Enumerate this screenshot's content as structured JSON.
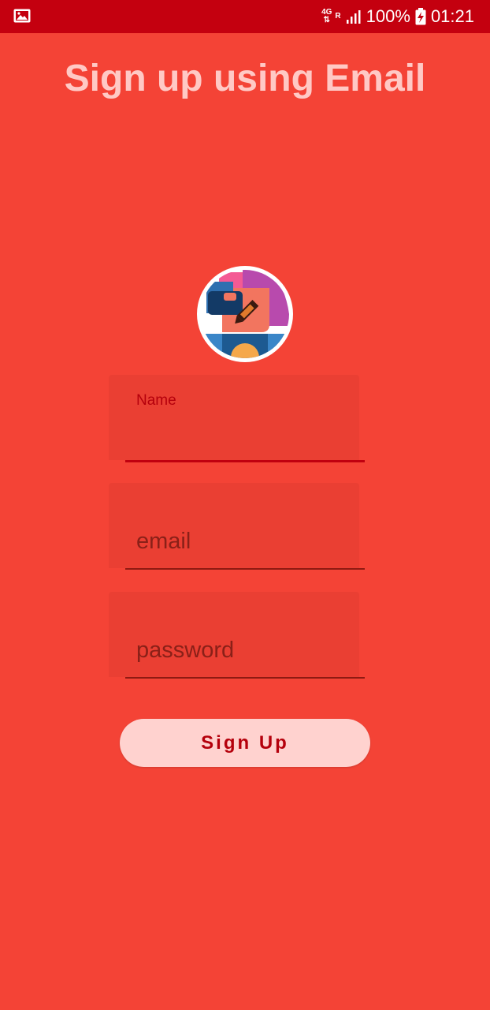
{
  "status_bar": {
    "network": "4G",
    "roaming": "R",
    "battery": "100%",
    "time": "01:21",
    "icons": [
      "image-icon",
      "signal-icon",
      "battery-charging-icon"
    ]
  },
  "title": "Sign up using Email",
  "form": {
    "name": {
      "label": "Name",
      "value": ""
    },
    "email": {
      "placeholder": "email",
      "value": ""
    },
    "password": {
      "placeholder": "password",
      "value": ""
    },
    "submit_label": "Sign Up"
  },
  "colors": {
    "background": "#f44336",
    "status_bar": "#c4000f",
    "accent": "#c0000f",
    "button_bg": "#ffd2cf"
  }
}
